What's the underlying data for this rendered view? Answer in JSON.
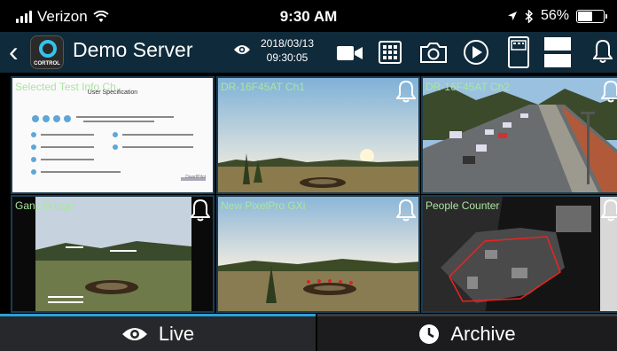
{
  "status": {
    "carrier": "Verizon",
    "time": "9:30 AM",
    "battery": "56%",
    "battery_level": 0.56
  },
  "toolbar": {
    "back_icon": "chevron-left-icon",
    "logo_text": "CORTROL",
    "server_name": "Demo Server",
    "date": "2018/03/13",
    "time": "09:30:05"
  },
  "cameras": [
    {
      "label": "Selected Test Info Ch",
      "alarm_icon": "bell-icon"
    },
    {
      "label": "DR-16F45AT Ch1",
      "alarm_icon": "bell-icon"
    },
    {
      "label": "DR-16F45AT Ch2",
      "alarm_icon": "bell-icon"
    },
    {
      "label": "Ganz Bridge",
      "alarm_icon": "bell-icon"
    },
    {
      "label": "New PixelPro GXi",
      "alarm_icon": "bell-icon"
    },
    {
      "label": "People Counter",
      "alarm_icon": "bell-icon"
    }
  ],
  "document": {
    "heading": "User Specification",
    "brand": "DwarfPilot"
  },
  "tabs": {
    "live": "Live",
    "archive": "Archive"
  },
  "colors": {
    "toolbar": "#0f2a3a",
    "accent": "#2aa1d8",
    "label_text": "#a9e6a0",
    "tab_bar": "#1c1c1e"
  }
}
